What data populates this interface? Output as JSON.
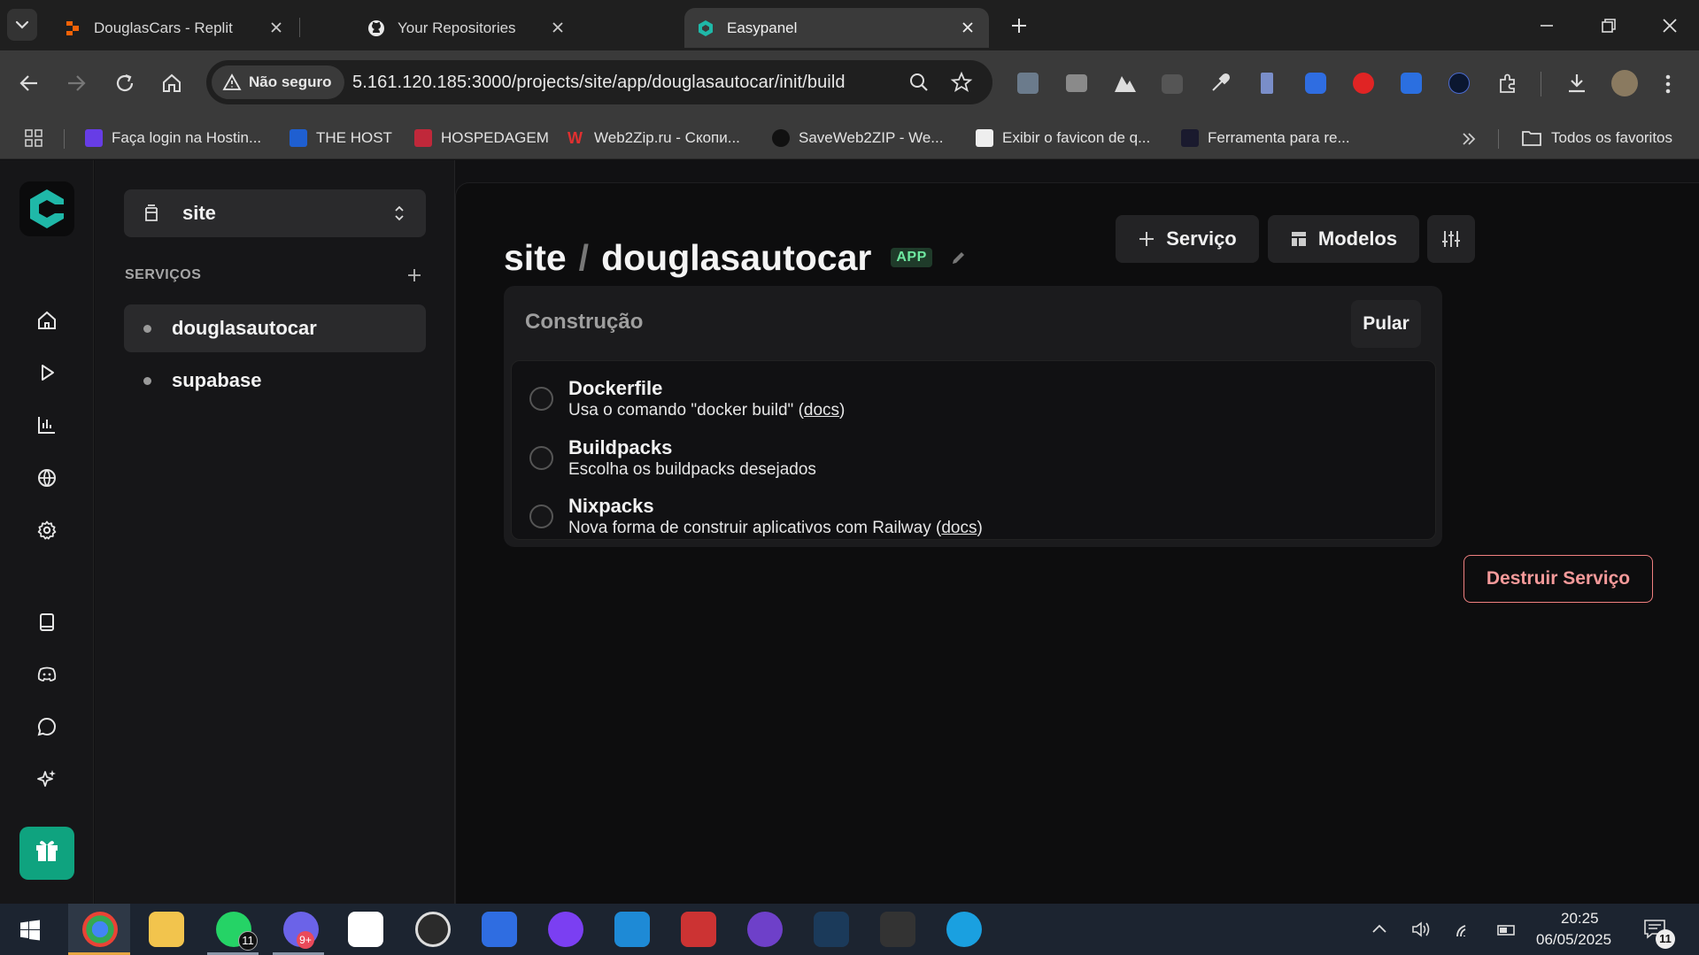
{
  "browser": {
    "tabs": [
      {
        "title": "DouglasCars - Replit",
        "active": false
      },
      {
        "title": "Your Repositories",
        "active": false
      },
      {
        "title": "Easypanel",
        "active": true
      }
    ],
    "security_label": "Não seguro",
    "url": "5.161.120.185:3000/projects/site/app/douglasautocar/init/build",
    "bookmarks": [
      "Faça login na Hostin...",
      "THE HOST",
      "HOSPEDAGEM",
      "Web2Zip.ru - Скопи...",
      "SaveWeb2ZIP - We...",
      "Exibir o favicon de q...",
      "Ferramenta para re..."
    ],
    "all_bookmarks": "Todos os favoritos"
  },
  "sidebar": {
    "project": "site",
    "services_heading": "SERVIÇOS",
    "services": [
      {
        "name": "douglasautocar",
        "selected": true
      },
      {
        "name": "supabase",
        "selected": false
      }
    ]
  },
  "header": {
    "project": "site",
    "separator": "/",
    "service": "douglasautocar",
    "badge": "APP",
    "add_service": "Serviço",
    "templates": "Modelos"
  },
  "build": {
    "title": "Construção",
    "skip": "Pular",
    "options": [
      {
        "title": "Dockerfile",
        "desc_before": "Usa o comando \"docker build\" (",
        "link": "docs",
        "desc_after": ")"
      },
      {
        "title": "Buildpacks",
        "desc_before": "Escolha os buildpacks desejados",
        "link": "",
        "desc_after": ""
      },
      {
        "title": "Nixpacks",
        "desc_before": "Nova forma de construir aplicativos com Railway (",
        "link": "docs",
        "desc_after": ")"
      }
    ]
  },
  "destroy": "Destruir Serviço",
  "taskbar": {
    "time": "20:25",
    "date": "06/05/2025",
    "whatsapp_badge": "11",
    "notif_badge": "11",
    "discord_badge": "9+"
  },
  "colors": {
    "accent": "#1fb8a8",
    "danger": "#f08080",
    "badge_bg": "#1f3b2a",
    "badge_fg": "#6ee7a0",
    "gift_bg": "#0fa37f"
  }
}
